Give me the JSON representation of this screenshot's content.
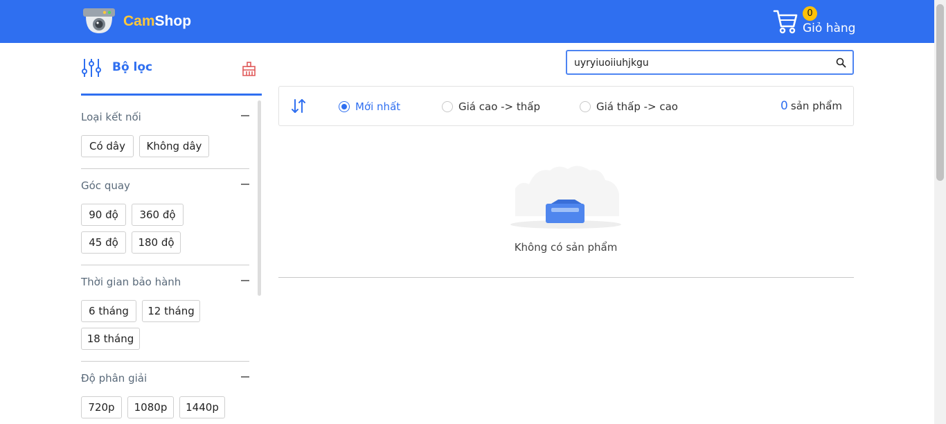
{
  "brand": {
    "name_part1": "Cam",
    "name_part2": "Shop"
  },
  "cart": {
    "count": "0",
    "label": "Giỏ hàng"
  },
  "sidebar": {
    "title": "Bộ lọc",
    "groups": [
      {
        "title": "Loại kết nối",
        "options": [
          "Có dây",
          "Không dây"
        ]
      },
      {
        "title": "Góc quay",
        "options": [
          "90 độ",
          "360 độ",
          "45 độ",
          "180 độ"
        ]
      },
      {
        "title": "Thời gian bảo hành",
        "options": [
          "6 tháng",
          "12 tháng",
          "18 tháng"
        ]
      },
      {
        "title": "Độ phân giải",
        "options": [
          "720p",
          "1080p",
          "1440p"
        ]
      }
    ]
  },
  "search": {
    "value": "uyryiuoiiuhjkgu"
  },
  "sort": {
    "options": [
      "Mới nhất",
      "Giá cao -> thấp",
      "Giá thấp -> cao"
    ],
    "selected": "Mới nhất"
  },
  "results": {
    "count": "0",
    "count_label": "sản phẩm",
    "empty_message": "Không có sản phẩm"
  },
  "colors": {
    "primary": "#2f6ff0",
    "accent": "#ffc83a",
    "clear_filter": "#e05a5a"
  },
  "icons": [
    "camera-logo-icon",
    "cart-icon",
    "filter-sliders-icon",
    "broom-icon",
    "search-icon",
    "sort-arrows-icon",
    "empty-box-icon"
  ]
}
